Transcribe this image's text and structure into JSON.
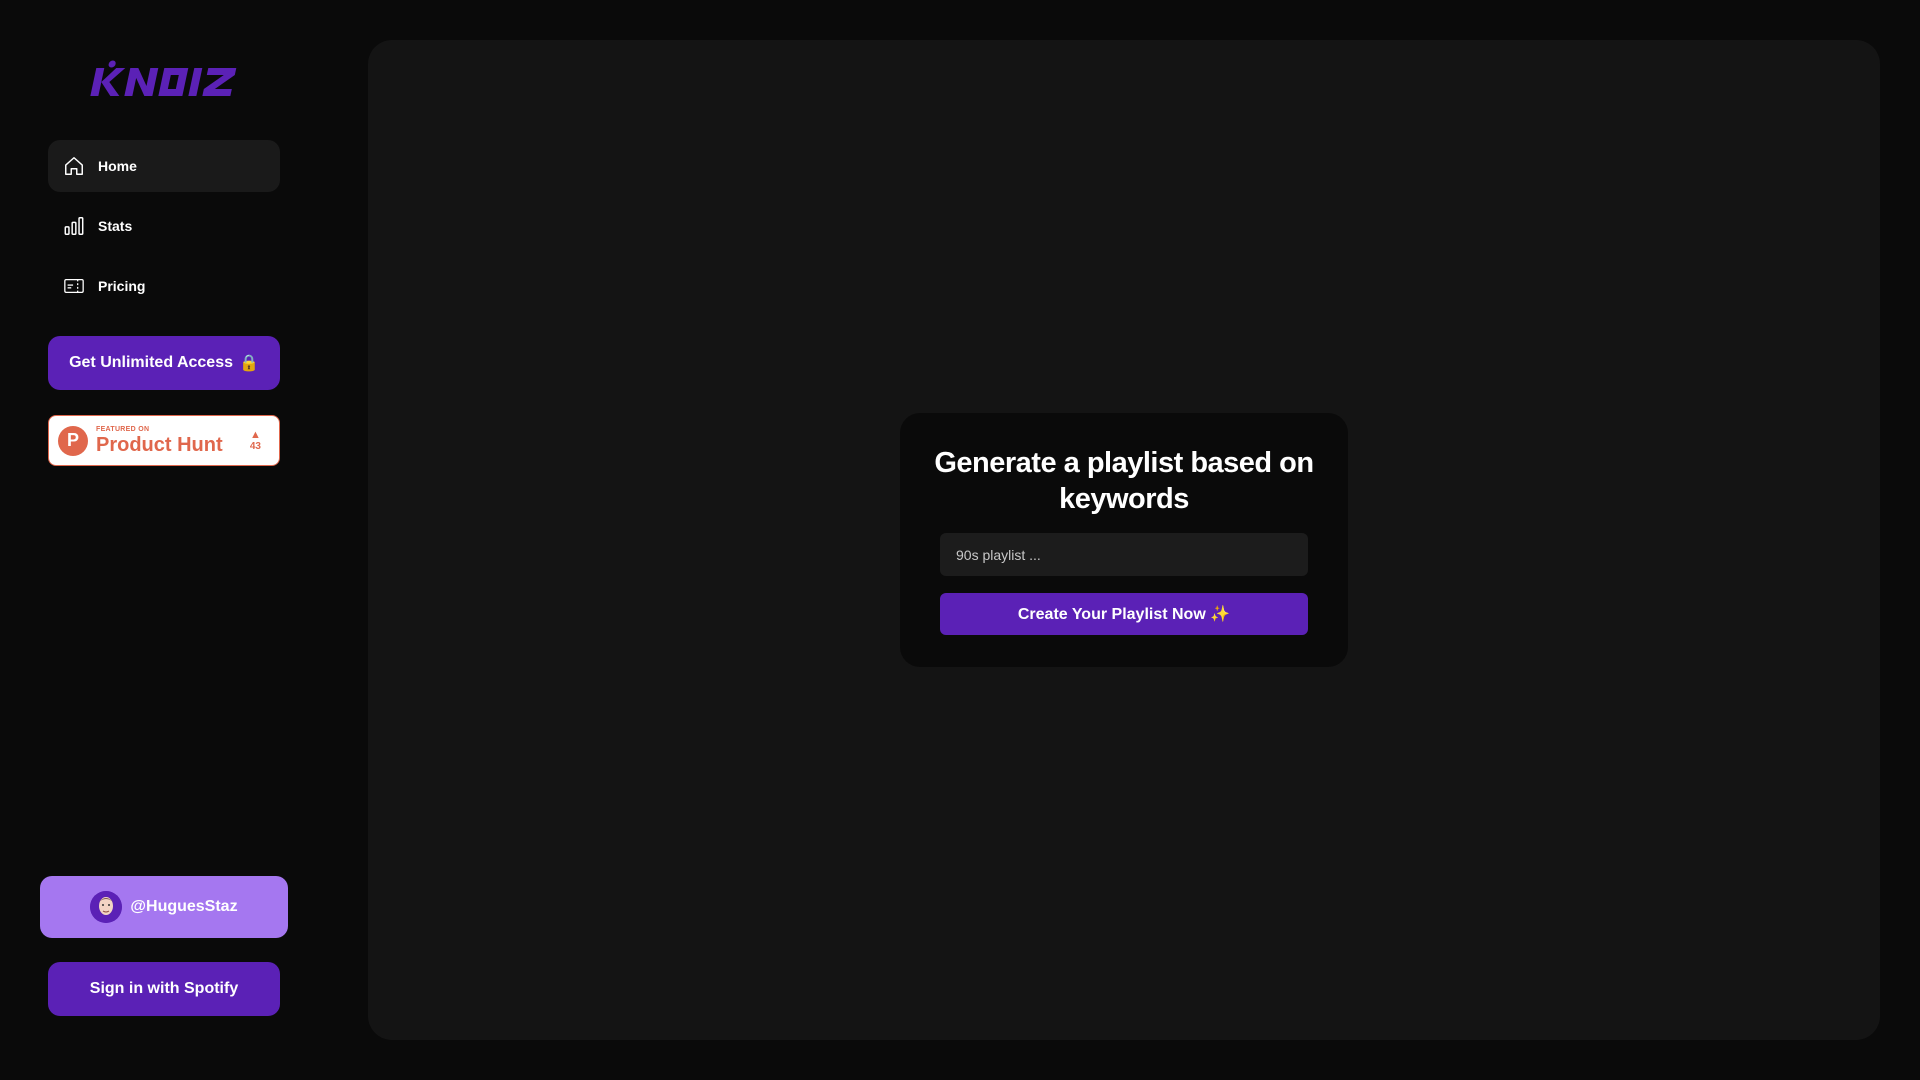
{
  "brand": {
    "logo_text": "KNOIZ",
    "accent_color": "#5b21b6",
    "logo_color": "#5b21b6"
  },
  "sidebar": {
    "nav": [
      {
        "label": "Home",
        "icon": "home-icon",
        "active": true
      },
      {
        "label": "Stats",
        "icon": "bar-chart-icon",
        "active": false
      },
      {
        "label": "Pricing",
        "icon": "ticket-icon",
        "active": false
      }
    ],
    "unlimited_label": "Get Unlimited Access",
    "unlimited_icon": "🔒",
    "product_hunt": {
      "featured_text": "FEATURED ON",
      "name": "Product Hunt",
      "votes": "43",
      "color": "#e0674c"
    },
    "user": {
      "handle": "@HuguesStaz",
      "pill_color": "#a577f0"
    },
    "spotify_label": "Sign in with Spotify"
  },
  "main": {
    "card": {
      "title": "Generate a playlist based on keywords",
      "input_placeholder": "90s playlist ...",
      "input_value": "",
      "button_label": "Create Your Playlist Now ✨"
    }
  }
}
